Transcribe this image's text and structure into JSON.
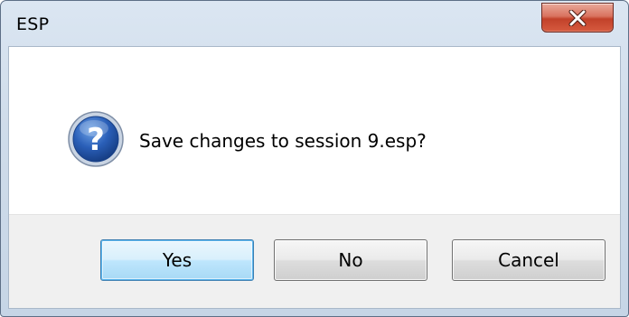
{
  "window": {
    "title": "ESP"
  },
  "dialog": {
    "icon": "question-icon",
    "message": "Save changes to session 9.esp?"
  },
  "buttons": {
    "yes": "Yes",
    "no": "No",
    "cancel": "Cancel"
  },
  "colors": {
    "close_button": "#c8452d",
    "default_button_border": "#3c7fb1",
    "question_icon": "#1f4fa0"
  }
}
